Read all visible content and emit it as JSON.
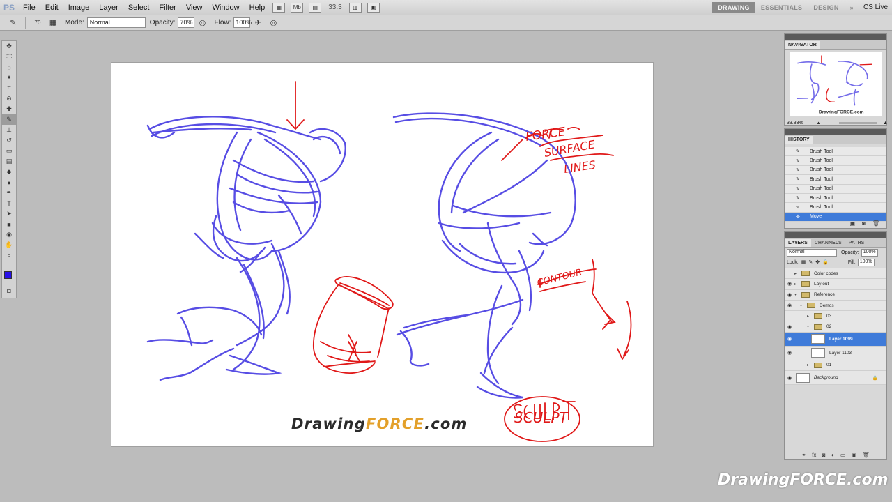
{
  "menu": {
    "logo": "PS",
    "items": [
      "File",
      "Edit",
      "Image",
      "Layer",
      "Select",
      "Filter",
      "View",
      "Window",
      "Help"
    ],
    "zoom": "33.3",
    "workspaces": [
      "DRAWING",
      "ESSENTIALS",
      "DESIGN"
    ],
    "active_workspace": "DRAWING",
    "cs_live": "CS Live"
  },
  "options": {
    "brush_size": "70",
    "mode_label": "Mode:",
    "mode_value": "Normal",
    "opacity_label": "Opacity:",
    "opacity_value": "70%",
    "flow_label": "Flow:",
    "flow_value": "100%"
  },
  "canvas": {
    "logo_prefix": "Drawing",
    "logo_accent": "FORCE",
    "logo_suffix": ".com",
    "annotations": {
      "force_surface_lines": [
        "FORCE",
        "SURFACE",
        "LINES"
      ],
      "contour": "CONTOUR",
      "sculpt": "SCULPT"
    }
  },
  "navigator": {
    "tab": "NAVIGATOR",
    "zoom": "33.33%"
  },
  "history": {
    "tab": "HISTORY",
    "items": [
      "Brush Tool",
      "Brush Tool",
      "Brush Tool",
      "Brush Tool",
      "Brush Tool",
      "Brush Tool",
      "Brush Tool",
      "Move"
    ]
  },
  "layers": {
    "tabs": [
      "LAYERS",
      "CHANNELS",
      "PATHS"
    ],
    "blend_mode": "Normal",
    "opacity_label": "Opacity:",
    "opacity": "100%",
    "lock_label": "Lock:",
    "fill_label": "Fill:",
    "fill": "100%",
    "rows": [
      {
        "name": "Color codes"
      },
      {
        "name": "Lay out"
      },
      {
        "name": "Reference"
      },
      {
        "name": "Demos"
      },
      {
        "name": "03"
      },
      {
        "name": "02"
      },
      {
        "name": "Layer 1099"
      },
      {
        "name": "Layer 1103"
      },
      {
        "name": "01"
      },
      {
        "name": "Background"
      }
    ]
  },
  "colors": {
    "foreground": "#2810e8",
    "background": "#4aa5f0",
    "selection": "#3f7bd9",
    "sketch_blue": "#3a2ee0",
    "annotation_red": "#e01818"
  },
  "watermark": "DrawingFORCE.com"
}
